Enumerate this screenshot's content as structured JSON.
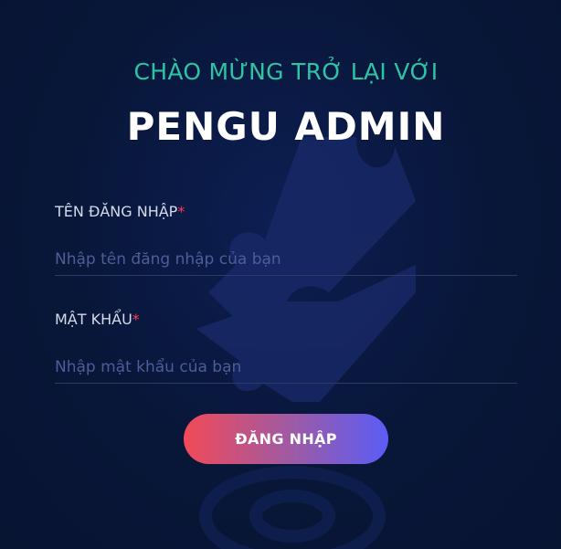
{
  "header": {
    "welcome": "CHÀO MỪNG TRỞ LẠI VỚI",
    "brand": "PENGU ADMIN"
  },
  "form": {
    "username": {
      "label": "TÊN ĐĂNG NHẬP",
      "required_mark": "*",
      "placeholder": "Nhập tên đăng nhập của bạn",
      "value": ""
    },
    "password": {
      "label": "MẬT KHẨU",
      "required_mark": "*",
      "placeholder": "Nhập mật khẩu của bạn",
      "value": ""
    },
    "submit_label": "ĐĂNG NHẬP"
  },
  "colors": {
    "background": "#071432",
    "welcome_text": "#2ec4a3",
    "required": "#ff3d4f",
    "button_gradient_start": "#f24a58",
    "button_gradient_end": "#5b5cf7"
  },
  "icons": {
    "watermark": "puzzle-icon"
  }
}
